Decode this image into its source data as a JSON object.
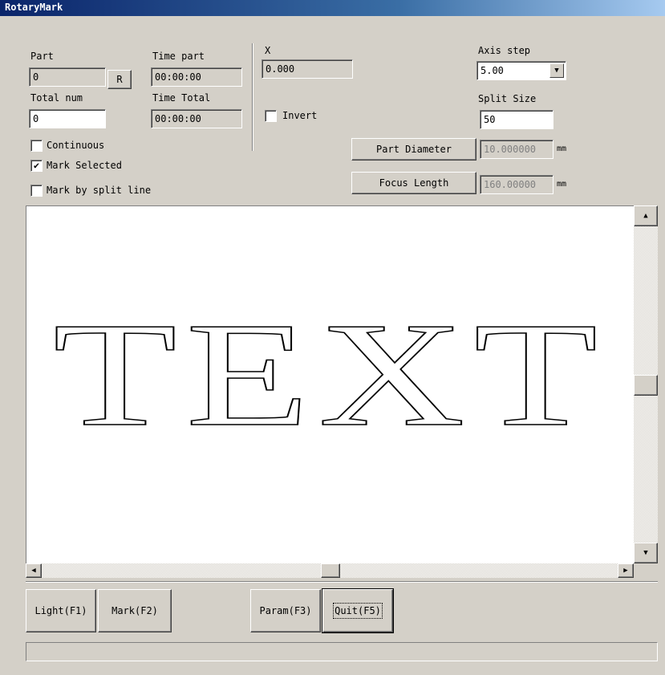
{
  "window": {
    "title": "RotaryMark"
  },
  "part": {
    "label": "Part",
    "value": "0",
    "reset_label": "R"
  },
  "time_part": {
    "label": "Time part",
    "value": "00:00:00"
  },
  "total_num": {
    "label": "Total num",
    "value": "0"
  },
  "time_total": {
    "label": "Time Total",
    "value": "00:00:00"
  },
  "x_axis": {
    "label": "X",
    "value": "0.000"
  },
  "invert": {
    "label": "Invert",
    "checked": false
  },
  "options": {
    "continuous": {
      "label": "Continuous",
      "checked": false
    },
    "mark_selected": {
      "label": "Mark Selected",
      "checked": true
    },
    "mark_by_split_line": {
      "label": "Mark by split line",
      "checked": false
    }
  },
  "axis_step": {
    "label": "Axis step",
    "value": "5.00",
    "arrow": "▼"
  },
  "split_size": {
    "label": "Split Size",
    "value": "50"
  },
  "part_diameter": {
    "button_label": "Part Diameter",
    "value": "10.000000",
    "unit": "mm"
  },
  "focus_length": {
    "button_label": "Focus Length",
    "value": "160.00000",
    "unit": "mm"
  },
  "preview": {
    "text": "TEXT"
  },
  "scroll": {
    "up": "▲",
    "down": "▼",
    "left": "◀",
    "right": "▶"
  },
  "buttons": {
    "light": "Light(F1)",
    "mark": "Mark(F2)",
    "param": "Param(F3)",
    "quit": "Quit(F5)"
  },
  "status": {
    "text": ""
  }
}
